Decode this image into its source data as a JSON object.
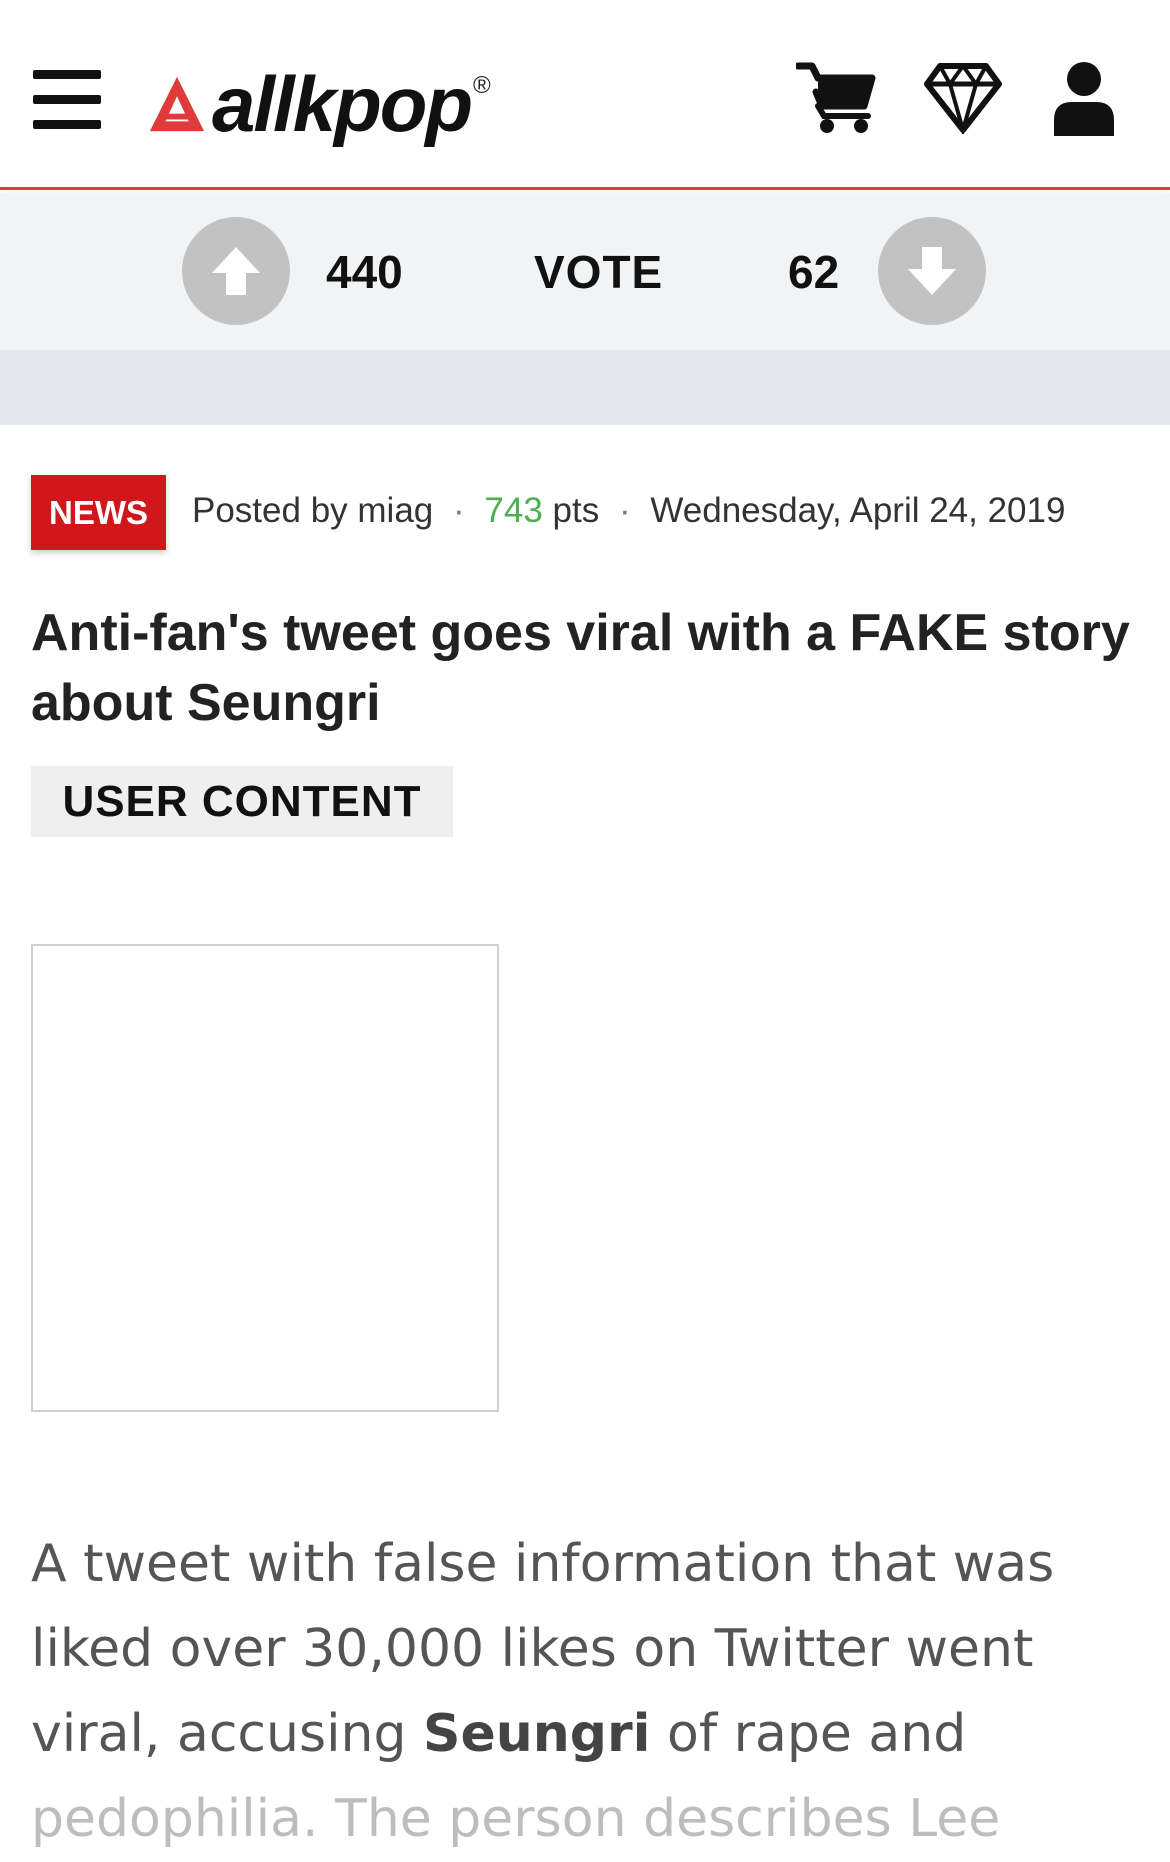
{
  "header": {
    "logo_text": "allkpop",
    "logo_reg": "®",
    "icons": [
      "menu-icon",
      "cart-icon",
      "gem-icon",
      "user-icon"
    ],
    "accent_color": "#e03a3a"
  },
  "vote": {
    "up_count": "440",
    "label": "VOTE",
    "down_count": "62"
  },
  "article": {
    "category": "NEWS",
    "posted_by_prefix": "Posted by",
    "author": "miag",
    "points_value": "743",
    "points_suffix": "pts",
    "date": "Wednesday, April 24, 2019",
    "title": "Anti-fan's tweet goes viral with a FAKE story about Seungri",
    "content_badge": "USER CONTENT",
    "body_before": "A tweet with false information that was liked over 30,000 likes on Twitter went viral, accusing ",
    "body_bold": "Seungri",
    "body_after": " of rape and",
    "body_cutoff": "pedophilia. The person describes Lee"
  },
  "colors": {
    "news_badge": "#d0171c",
    "points": "#4caf50",
    "vote_button": "#c2c2c2"
  }
}
